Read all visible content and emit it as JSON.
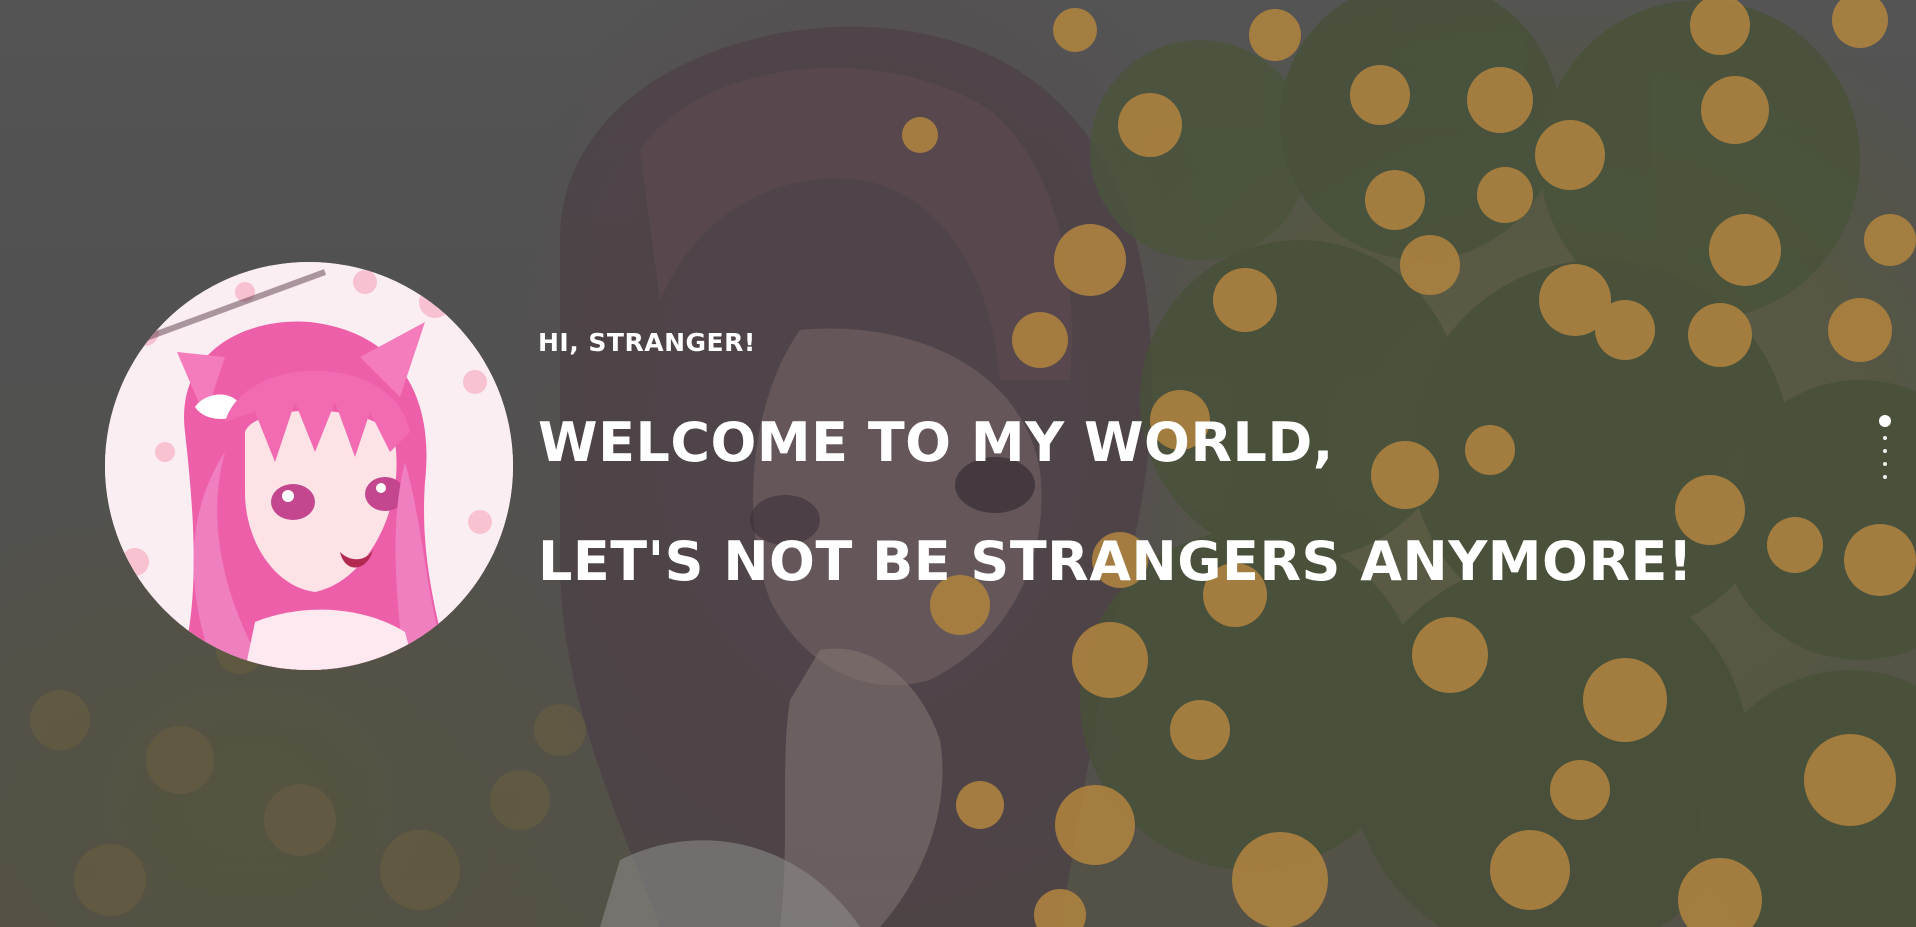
{
  "hero": {
    "greeting": "HI, STRANGER!",
    "headline_line1": "WELCOME TO MY WORLD,",
    "headline_line2": "LET'S NOT BE STRANGERS ANYMORE!"
  },
  "avatar": {
    "icon": "anime-cat-girl-avatar"
  },
  "background": {
    "icon": "anime-girl-with-yellow-flowers-illustration"
  },
  "pagination": {
    "total": 5,
    "active_index": 0
  },
  "colors": {
    "text": "#ffffff",
    "flower_accent": "#e8a94a",
    "avatar_hair": "#f06bb5"
  }
}
